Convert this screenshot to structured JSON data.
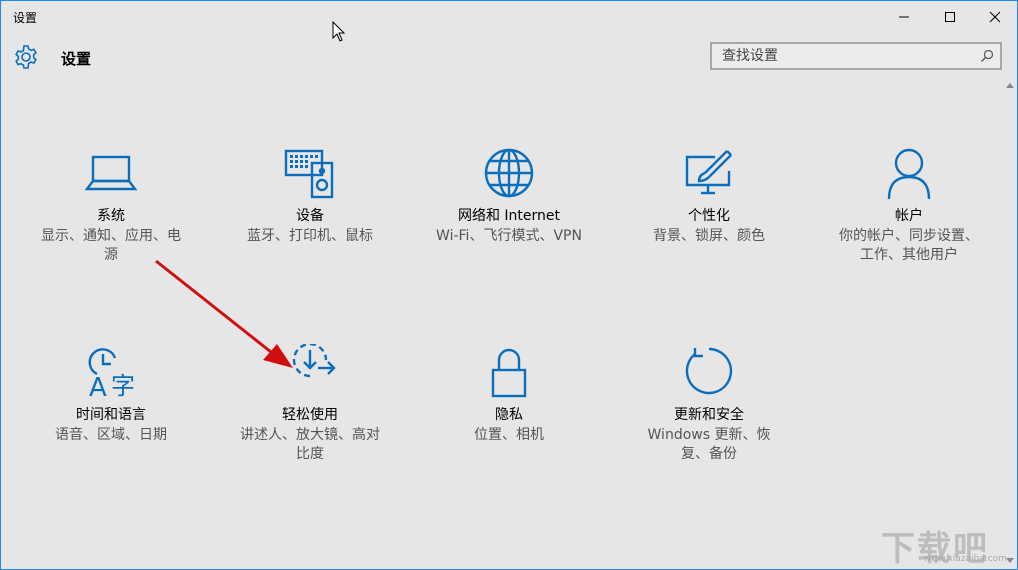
{
  "window": {
    "title": "设置",
    "controls": {
      "minimize": "minimize",
      "maximize": "maximize",
      "close": "close"
    }
  },
  "header": {
    "title": "设置",
    "icon": "gear-icon"
  },
  "search": {
    "placeholder": "查找设置",
    "icon": "search-icon"
  },
  "colors": {
    "accent": "#0a6ebd",
    "window_border": "#1e88e5",
    "background": "#e6e6e6",
    "annotation_arrow": "#d01010"
  },
  "tiles": [
    {
      "name": "系统",
      "desc_lines": [
        "显示、通知、应用、电",
        "源"
      ],
      "icon": "laptop-icon"
    },
    {
      "name": "设备",
      "desc_lines": [
        "蓝牙、打印机、鼠标"
      ],
      "icon": "devices-icon"
    },
    {
      "name": "网络和 Internet",
      "desc_lines": [
        "Wi-Fi、飞行模式、VPN"
      ],
      "icon": "globe-icon"
    },
    {
      "name": "个性化",
      "desc_lines": [
        "背景、锁屏、颜色"
      ],
      "icon": "personalization-icon"
    },
    {
      "name": "帐户",
      "desc_lines": [
        "你的帐户、同步设置、",
        "工作、其他用户"
      ],
      "icon": "person-icon"
    },
    {
      "name": "时间和语言",
      "desc_lines": [
        "语音、区域、日期"
      ],
      "icon": "time-language-icon"
    },
    {
      "name": "轻松使用",
      "desc_lines": [
        "讲述人、放大镜、高对",
        "比度"
      ],
      "icon": "ease-of-access-icon"
    },
    {
      "name": "隐私",
      "desc_lines": [
        "位置、相机"
      ],
      "icon": "lock-icon"
    },
    {
      "name": "更新和安全",
      "desc_lines": [
        "Windows 更新、恢",
        "复、备份"
      ],
      "icon": "update-icon"
    }
  ],
  "watermark": {
    "text": "下载吧",
    "sub": "www.xiazaiba.com"
  }
}
